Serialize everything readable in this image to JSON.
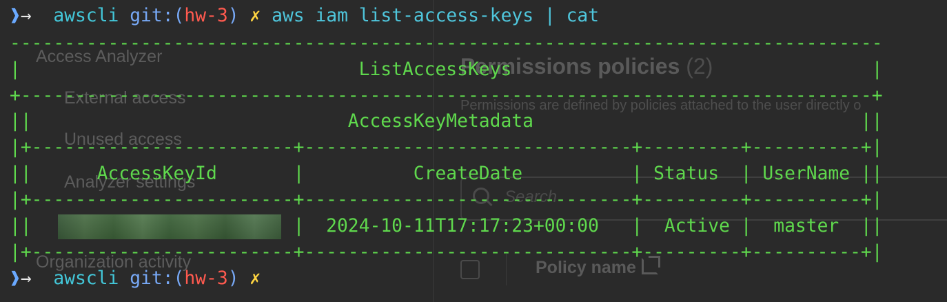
{
  "background_console": {
    "sidebar_items": [
      "Access Analyzer",
      "External access",
      "Unused access",
      "Analyzer settings",
      "Organization activity"
    ],
    "section_title": "Permissions policies",
    "section_count": "(2)",
    "section_description": "Permissions are defined by policies attached to the user directly o",
    "search_placeholder": "Search",
    "policy_column": "Policy name"
  },
  "terminal": {
    "prompt1": {
      "dir": "awscli",
      "git_label": "git:",
      "paren_open": "(",
      "branch": "hw-3",
      "paren_close": ")",
      "dirty": "✗",
      "command": "aws iam list-access-keys | cat"
    },
    "table_lines": [
      "--------------------------------------------------------------------------------",
      "|                               ListAccessKeys                                 |",
      "+------------------------------------------------------------------------------+",
      "||                             AccessKeyMetadata                              ||",
      "|+------------------------+------------------------------+---------+----------+|",
      "||      AccessKeyId       |          CreateDate          | Status  | UserName ||",
      "|+------------------------+------------------------------+---------+----------+|",
      "||                        |  2024-10-11T17:17:23+00:00   |  Active |  master  ||",
      "|+------------------------+------------------------------+---------+----------+|"
    ],
    "prompt2": {
      "dir": "awscli",
      "git_label": "git:",
      "paren_open": "(",
      "branch": "hw-3",
      "paren_close": ")",
      "dirty": "✗"
    },
    "colors": {
      "table": "#5fd84d",
      "dir": "#43c6d8",
      "branch": "#ff5a4f",
      "dirty": "#ffd541"
    }
  }
}
